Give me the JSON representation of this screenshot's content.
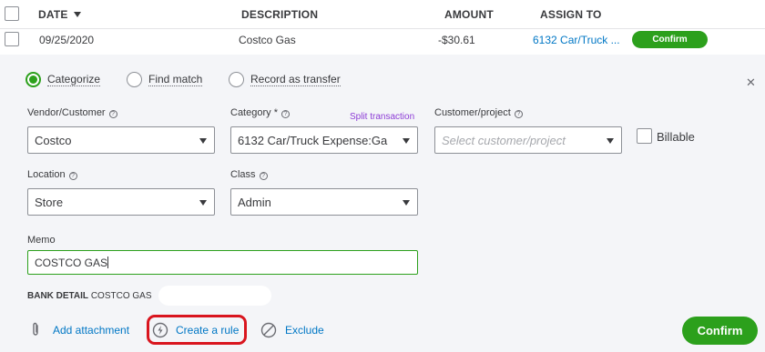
{
  "header": {
    "date": "DATE",
    "description": "DESCRIPTION",
    "amount": "AMOUNT",
    "assign_to": "ASSIGN TO"
  },
  "transaction": {
    "date": "09/25/2020",
    "description": "Costco Gas",
    "amount": "-$30.61",
    "assign_to": "6132 Car/Truck ...",
    "confirm_label": "Confirm"
  },
  "options": {
    "categorize": "Categorize",
    "find_match": "Find match",
    "record_transfer": "Record as transfer",
    "selected": "categorize"
  },
  "fields": {
    "vendor": {
      "label": "Vendor/Customer",
      "value": "Costco"
    },
    "category": {
      "label": "Category *",
      "value": "6132 Car/Truck Expense:Ga"
    },
    "split_link": "Split transaction",
    "customer": {
      "label": "Customer/project",
      "placeholder": "Select customer/project"
    },
    "billable": {
      "label": "Billable",
      "checked": false
    },
    "location": {
      "label": "Location",
      "value": "Store"
    },
    "class": {
      "label": "Class",
      "value": "Admin"
    },
    "memo": {
      "label": "Memo",
      "value": "COSTCO GAS"
    }
  },
  "bank_detail": {
    "label": "BANK DETAIL",
    "value": "COSTCO GAS"
  },
  "actions": {
    "add_attachment": "Add attachment",
    "create_rule": "Create a rule",
    "exclude": "Exclude",
    "confirm": "Confirm"
  },
  "colors": {
    "accent_green": "#2ca01c",
    "link_blue": "#0077c5",
    "highlight_red": "#d9151e",
    "split_purple": "#8d3dd6"
  },
  "icons": [
    "caret-down-icon",
    "help-icon",
    "close-icon",
    "paperclip-icon",
    "lightning-icon",
    "block-icon"
  ]
}
